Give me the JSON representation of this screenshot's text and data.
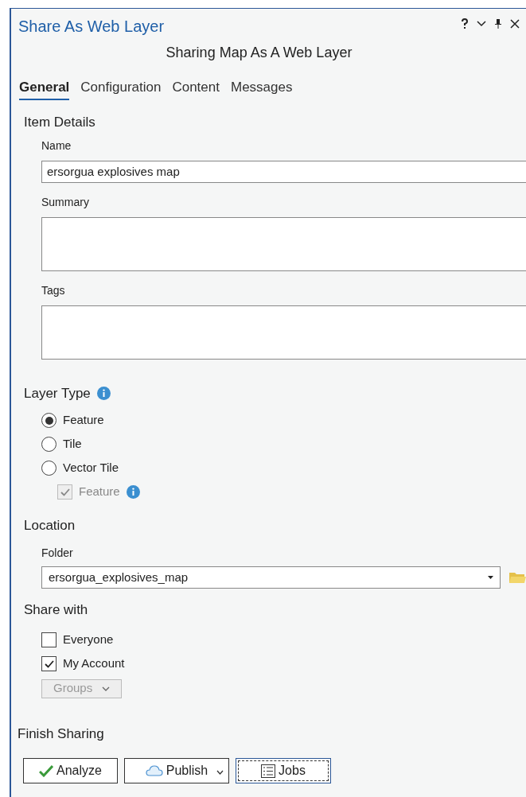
{
  "window": {
    "title": "Share As Web Layer",
    "subtitle": "Sharing Map As A Web Layer"
  },
  "tabs": [
    {
      "label": "General",
      "selected": true
    },
    {
      "label": "Configuration",
      "selected": false
    },
    {
      "label": "Content",
      "selected": false
    },
    {
      "label": "Messages",
      "selected": false
    }
  ],
  "item_details": {
    "heading": "Item Details",
    "fields": [
      {
        "label": "Name",
        "value": "ersorgua explosives map",
        "kind": "line"
      },
      {
        "label": "Summary",
        "kind": "area"
      },
      {
        "label": "Tags",
        "kind": "area"
      }
    ]
  },
  "layer_type": {
    "heading": "Layer Type",
    "options": [
      {
        "label": "Feature",
        "selected": true,
        "kind": "radio"
      },
      {
        "label": "Tile",
        "selected": false,
        "kind": "radio"
      },
      {
        "label": "Vector Tile",
        "selected": false,
        "kind": "radio"
      },
      {
        "label": "Feature",
        "checked": true,
        "disabled": true,
        "kind": "checkbox"
      }
    ]
  },
  "location": {
    "heading": "Location",
    "folder_label": "Folder",
    "folder_value": "ersorgua_explosives_map"
  },
  "share_with": {
    "heading": "Share with",
    "options": [
      {
        "label": "Everyone",
        "checked": false
      },
      {
        "label": "My Account",
        "checked": true
      }
    ],
    "groups": {
      "label": "Groups",
      "disabled": true
    }
  },
  "finish_sharing": {
    "heading": "Finish Sharing",
    "buttons": [
      {
        "label": "Analyze",
        "kind": "check"
      },
      {
        "label": "Publish",
        "kind": "cloud"
      },
      {
        "label": "Jobs",
        "kind": "list"
      }
    ]
  }
}
